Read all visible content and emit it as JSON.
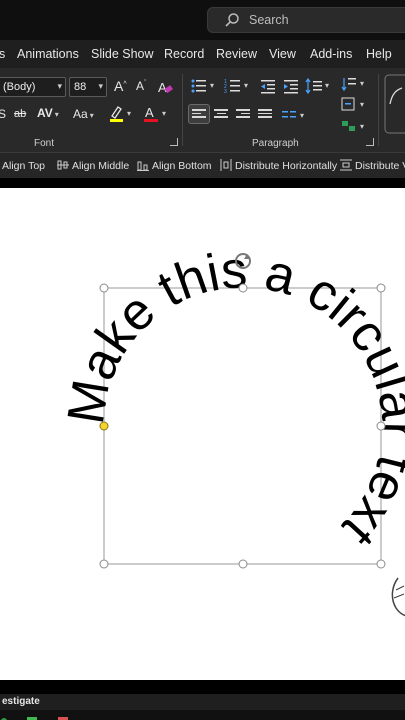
{
  "search": {
    "label": "Search"
  },
  "menu": {
    "items": [
      {
        "label": "s"
      },
      {
        "label": "Animations"
      },
      {
        "label": "Slide Show"
      },
      {
        "label": "Record"
      },
      {
        "label": "Review"
      },
      {
        "label": "View"
      },
      {
        "label": "Add-ins"
      },
      {
        "label": "Help"
      }
    ]
  },
  "ribbon": {
    "font": {
      "name_value": "(Body)",
      "size_value": "88",
      "group_label": "Font",
      "char_spacing_label": "AV",
      "change_case_label": "Aa",
      "grow_label": "A",
      "shrink_label": "A",
      "strike_label": "ab",
      "highlight_color": "#ffff00",
      "font_color": "#e81123"
    },
    "paragraph": {
      "group_label": "Paragraph"
    }
  },
  "align_bar": {
    "items": [
      {
        "label": "Align Top"
      },
      {
        "label": "Align Middle"
      },
      {
        "label": "Align Bottom"
      },
      {
        "label": "Distribute Horizontally"
      },
      {
        "label": "Distribute Ve"
      }
    ]
  },
  "slide": {
    "circular_text": "Make this a circular text"
  },
  "status": {
    "text": "estigate"
  }
}
